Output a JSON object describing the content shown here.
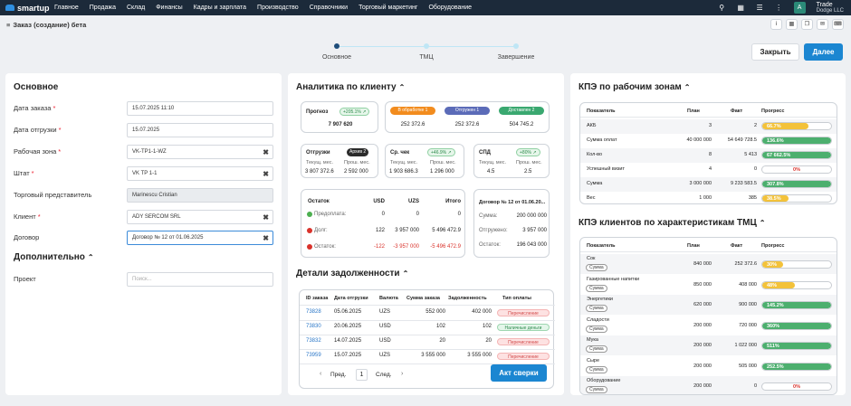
{
  "nav": {
    "logo": "smartup",
    "items": [
      "Главное",
      "Продажа",
      "Склад",
      "Финансы",
      "Кадры и зарплата",
      "Производство",
      "Справочники",
      "Торговый маркетинг",
      "Оборудование"
    ],
    "avatar": "A",
    "company_line1": "Trade",
    "company_line2": "Dodge LLC"
  },
  "page": {
    "title": "Заказ (создание) бета"
  },
  "stepper": {
    "steps": [
      "Основное",
      "ТМЦ",
      "Завершение"
    ]
  },
  "actions": {
    "close": "Закрыть",
    "next": "Далее"
  },
  "form": {
    "title": "Основное",
    "fields": [
      {
        "label": "Дата заказа",
        "required": true,
        "value": "15.07.2025 11:10"
      },
      {
        "label": "Дата отгрузки",
        "required": true,
        "value": "15.07.2025"
      },
      {
        "label": "Рабочая зона",
        "required": true,
        "value": "VK-TP1-1-WZ"
      },
      {
        "label": "Штат",
        "required": true,
        "value": "VK  TP 1-1"
      },
      {
        "label": "Торговый представитель",
        "required": false,
        "value": "Marinescu Cristian"
      },
      {
        "label": "Клиент",
        "required": true,
        "value": "ADY SERCOM SRL"
      },
      {
        "label": "Договор",
        "required": false,
        "value": "Договор № 12 от 01.06.2025"
      }
    ],
    "extra_title": "Дополнительно",
    "project_label": "Проект",
    "project_placeholder": "Поиск..."
  },
  "analytics": {
    "title": "Аналитика по клиенту",
    "forecast": {
      "label": "Прогноз",
      "badge": "+205.1%",
      "value": "7 907 620"
    },
    "statuses": [
      {
        "label": "В обработке 1",
        "value": "252 372.6"
      },
      {
        "label": "Отгружен 1",
        "value": "252 372.6"
      },
      {
        "label": "Доставлен 2",
        "value": "504 745.2"
      }
    ],
    "shipments": {
      "label": "Отгрузки",
      "badge": "Архив 2",
      "cur_label": "Текущ. мес.",
      "prev_label": "Прош. мес.",
      "cur": "3 807 372.6",
      "prev": "2 592 000"
    },
    "avg_check": {
      "label": "Ср. чек",
      "badge": "+46.9%",
      "cur_label": "Текущ. мес.",
      "prev_label": "Прош. мес.",
      "cur": "1 903 686.3",
      "prev": "1 296 000"
    },
    "spd": {
      "label": "СПД",
      "badge": "+80%",
      "cur_label": "Текущ. мес.",
      "prev_label": "Прош. мес.",
      "cur": "4.5",
      "prev": "2.5"
    },
    "balance": {
      "headers": [
        "Остаток",
        "USD",
        "UZS",
        "Итого"
      ],
      "rows": [
        {
          "label": "Предоплата:",
          "usd": "0",
          "uzs": "0",
          "total": "0",
          "color": "#4caf50",
          "red": false
        },
        {
          "label": "Долг:",
          "usd": "122",
          "uzs": "3 957 000",
          "total": "5 496 472.9",
          "color": "#d9322b",
          "red": false
        },
        {
          "label": "Остаток:",
          "usd": "-122",
          "uzs": "-3 957 000",
          "total": "-5 496 472.9",
          "color": "#d9322b",
          "red": true
        }
      ]
    },
    "contract": {
      "title": "Договор № 12 от 01.06.20...",
      "rows": [
        {
          "label": "Сумма:",
          "value": "200 000 000"
        },
        {
          "label": "Отгружено:",
          "value": "3 957 000"
        },
        {
          "label": "Остаток:",
          "value": "196 043 000"
        }
      ]
    }
  },
  "debt": {
    "title": "Детали задолженности",
    "headers": [
      "ID заказа",
      "Дата отгрузки",
      "Валюта",
      "Сумма заказа",
      "Задолженность",
      "Тип оплаты"
    ],
    "rows": [
      {
        "id": "73828",
        "date": "05.06.2025",
        "currency": "UZS",
        "amount": "552 000",
        "debt": "402 000",
        "type": "Перечисление",
        "cash": false
      },
      {
        "id": "73830",
        "date": "20.06.2025",
        "currency": "USD",
        "amount": "102",
        "debt": "102",
        "type": "Наличные деньги",
        "cash": true
      },
      {
        "id": "73832",
        "date": "14.07.2025",
        "currency": "USD",
        "amount": "20",
        "debt": "20",
        "type": "Перечисление",
        "cash": false
      },
      {
        "id": "73959",
        "date": "15.07.2025",
        "currency": "UZS",
        "amount": "3 555 000",
        "debt": "3 555 000",
        "type": "Перечисление",
        "cash": false
      }
    ],
    "prev": "Пред.",
    "page": "1",
    "next": "След.",
    "akt": "Акт сверки"
  },
  "kpi_zones": {
    "title": "КПЭ по рабочим зонам",
    "headers": [
      "Показатель",
      "План",
      "Факт",
      "Прогресс"
    ],
    "rows": [
      {
        "name": "АКБ",
        "plan": "3",
        "fact": "2",
        "progress": "66.7%",
        "pct": 66.7,
        "color": "#f3c23a"
      },
      {
        "name": "Сумма оплат",
        "plan": "40 000 000",
        "fact": "54 649 728.5",
        "progress": "136.6%",
        "pct": 100,
        "color": "#4caf6e"
      },
      {
        "name": "Кол-во",
        "plan": "8",
        "fact": "5 413",
        "progress": "67 662.5%",
        "pct": 100,
        "color": "#4caf6e"
      },
      {
        "name": "Успешный визит",
        "plan": "4",
        "fact": "0",
        "progress": "0%",
        "pct": 0,
        "color": "#d9322b"
      },
      {
        "name": "Сумма",
        "plan": "3 000 000",
        "fact": "9 233 583.5",
        "progress": "307.8%",
        "pct": 100,
        "color": "#4caf6e"
      },
      {
        "name": "Вес",
        "plan": "1 000",
        "fact": "385",
        "progress": "38.5%",
        "pct": 38.5,
        "color": "#f3c23a"
      }
    ]
  },
  "kpi_clients": {
    "title": "КПЭ клиентов по характеристикам ТМЦ",
    "headers": [
      "Показатель",
      "План",
      "Факт",
      "Прогресс"
    ],
    "chip": "Сумма",
    "rows": [
      {
        "name": "Сок",
        "plan": "840 000",
        "fact": "252 372.6",
        "progress": "30%",
        "pct": 30,
        "color": "#f3c23a"
      },
      {
        "name": "Газированные напитки",
        "plan": "850 000",
        "fact": "408 000",
        "progress": "48%",
        "pct": 48,
        "color": "#f3c23a"
      },
      {
        "name": "Энергетики",
        "plan": "620 000",
        "fact": "900 000",
        "progress": "145.2%",
        "pct": 100,
        "color": "#4caf6e"
      },
      {
        "name": "Сладости",
        "plan": "200 000",
        "fact": "720 000",
        "progress": "360%",
        "pct": 100,
        "color": "#4caf6e"
      },
      {
        "name": "Мука",
        "plan": "200 000",
        "fact": "1 022 000",
        "progress": "511%",
        "pct": 100,
        "color": "#4caf6e"
      },
      {
        "name": "Сыре",
        "plan": "200 000",
        "fact": "505 000",
        "progress": "252.5%",
        "pct": 100,
        "color": "#4caf6e"
      },
      {
        "name": "Оборудование",
        "plan": "200 000",
        "fact": "0",
        "progress": "0%",
        "pct": 0,
        "color": "#d9322b"
      }
    ]
  }
}
